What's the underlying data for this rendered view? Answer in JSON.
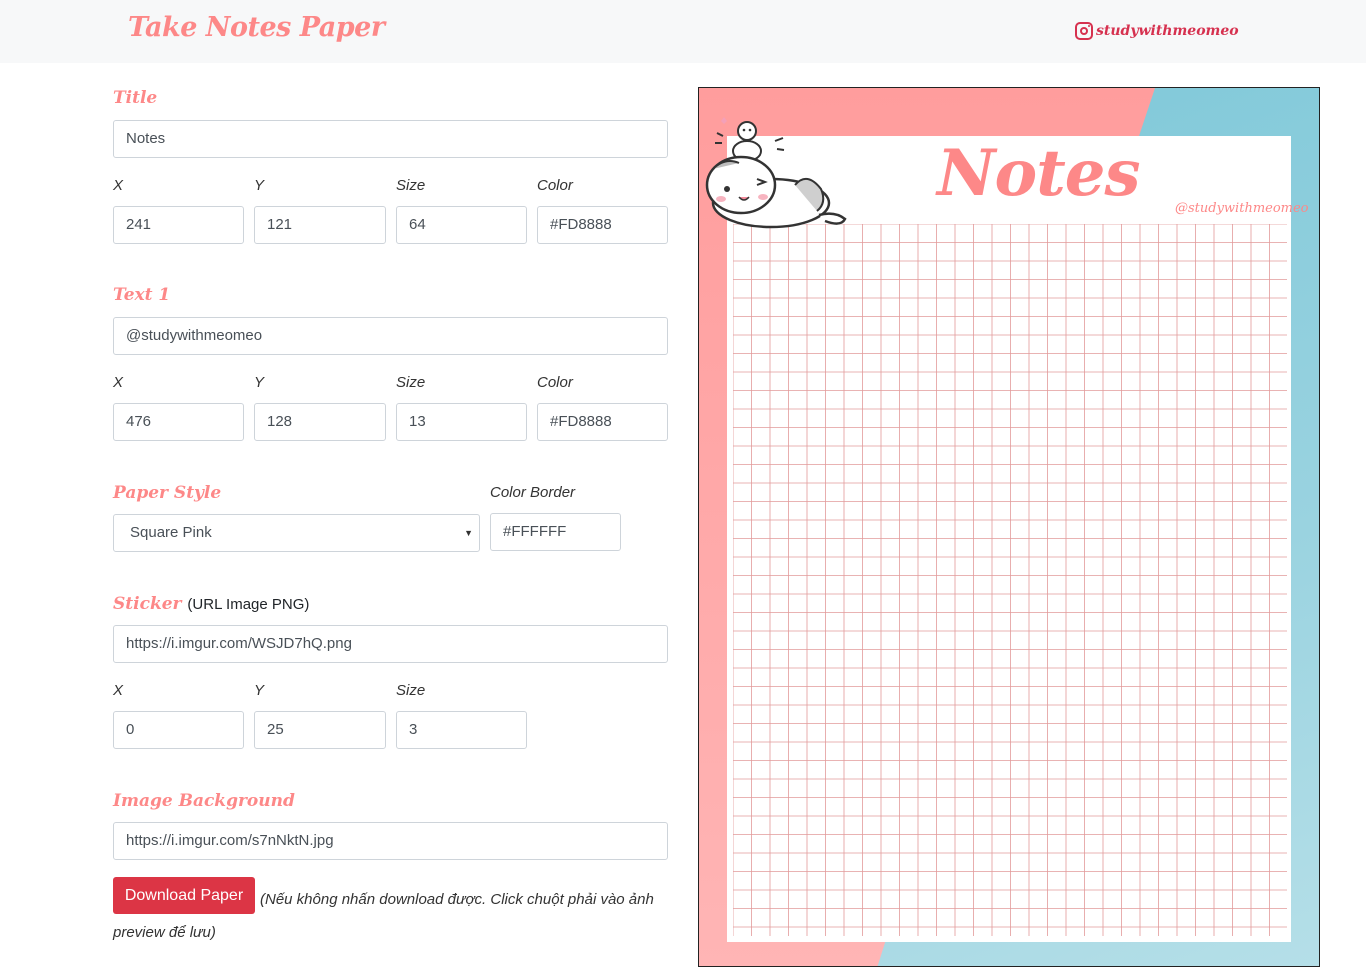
{
  "header": {
    "brand": "Take Notes Paper",
    "instagram_handle": "studywithmeomeo"
  },
  "title_section": {
    "label": "Title",
    "value": "Notes",
    "x_label": "X",
    "y_label": "Y",
    "size_label": "Size",
    "color_label": "Color",
    "x": "241",
    "y": "121",
    "size": "64",
    "color": "#FD8888"
  },
  "text1_section": {
    "label": "Text 1",
    "value": "@studywithmeomeo",
    "x_label": "X",
    "y_label": "Y",
    "size_label": "Size",
    "color_label": "Color",
    "x": "476",
    "y": "128",
    "size": "13",
    "color": "#FD8888"
  },
  "paper_style": {
    "label": "Paper Style",
    "selected": "Square Pink",
    "border_label": "Color Border",
    "border_color": "#FFFFFF"
  },
  "sticker_section": {
    "label": "Sticker",
    "hint": "(URL Image PNG)",
    "url": "https://i.imgur.com/WSJD7hQ.png",
    "x_label": "X",
    "y_label": "Y",
    "size_label": "Size",
    "x": "0",
    "y": "25",
    "size": "3"
  },
  "background_section": {
    "label": "Image Background",
    "url": "https://i.imgur.com/s7nNktN.jpg"
  },
  "actions": {
    "download_label": "Download Paper",
    "note": "(Nếu không nhấn download được. Click chuột phải vào ảnh preview để lưu)"
  },
  "preview": {
    "title": "Notes",
    "text1": "@studywithmeomeo",
    "grid_color": "#e29a9a",
    "accent": "#FD8888"
  }
}
